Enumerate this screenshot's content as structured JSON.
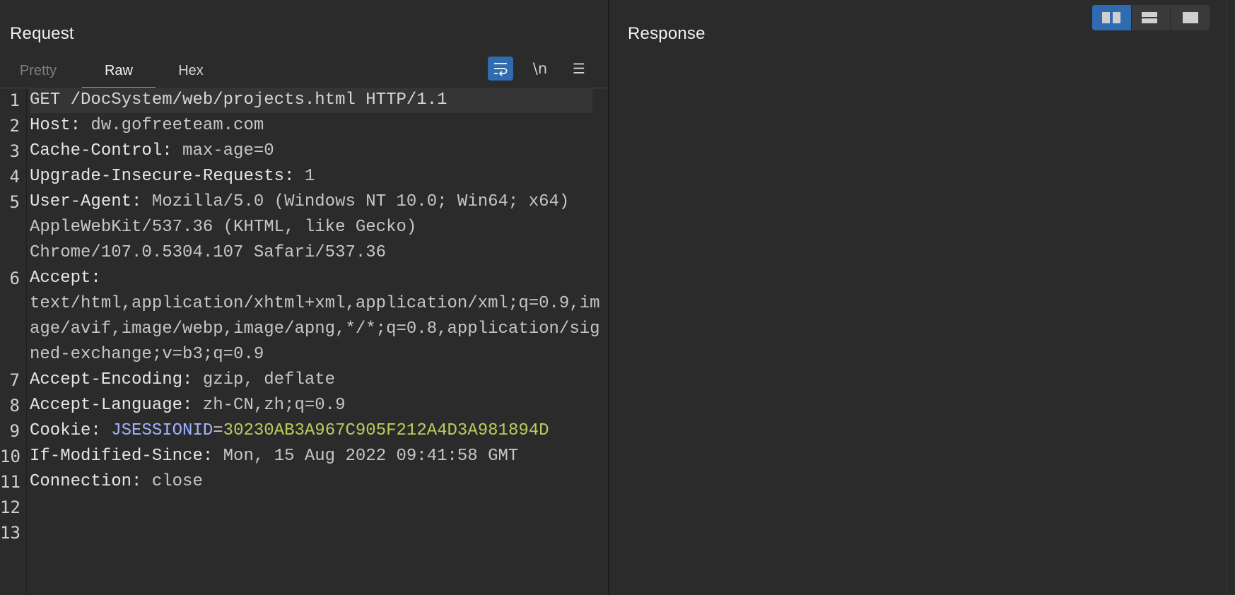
{
  "request": {
    "title": "Request",
    "tabs": {
      "pretty": "Pretty",
      "raw": "Raw",
      "hex": "Hex"
    },
    "toolbar": {
      "newline_label": "\\n",
      "menu_label": "☰"
    },
    "lines": [
      {
        "num": "1",
        "text": "GET /DocSystem/web/projects.html HTTP/1.1"
      },
      {
        "num": "2",
        "name": "Host:",
        "value": " dw.gofreeteam.com"
      },
      {
        "num": "3",
        "name": "Cache-Control:",
        "value": " max-age=0"
      },
      {
        "num": "4",
        "name": "Upgrade-Insecure-Requests:",
        "value": " 1"
      },
      {
        "num": "5",
        "name": "User-Agent:",
        "value": " Mozilla/5.0 (Windows NT 10.0; Win64; x64)",
        "cont": [
          "AppleWebKit/537.36 (KHTML, like Gecko)",
          "Chrome/107.0.5304.107 Safari/537.36"
        ]
      },
      {
        "num": "6",
        "name": "Accept:",
        "value": "",
        "cont": [
          "text/html,application/xhtml+xml,application/xml;q=0.9,im",
          "age/avif,image/webp,image/apng,*/*;q=0.8,application/sig",
          "ned-exchange;v=b3;q=0.9"
        ]
      },
      {
        "num": "7",
        "name": "Accept-Encoding:",
        "value": " gzip, deflate"
      },
      {
        "num": "8",
        "name": "Accept-Language:",
        "value": " zh-CN,zh;q=0.9"
      },
      {
        "num": "9",
        "name": "Cookie:",
        "cookie_name": " JSESSIONID",
        "cookie_eq": "=",
        "cookie_value": "30230AB3A967C905F212A4D3A981894D"
      },
      {
        "num": "10",
        "name": "If-Modified-Since:",
        "value": " Mon, 15 Aug 2022 09:41:58 GMT"
      },
      {
        "num": "11",
        "name": "Connection:",
        "value": " close"
      },
      {
        "num": "12"
      },
      {
        "num": "13"
      }
    ]
  },
  "response": {
    "title": "Response"
  },
  "layout_toggle": {
    "selected": "side-by-side"
  },
  "colors": {
    "accent_blue": "#2f6bb0",
    "tab_underline": "#e07b39",
    "cookie_name": "#9fb4ff",
    "cookie_value": "#b7cf5c"
  }
}
